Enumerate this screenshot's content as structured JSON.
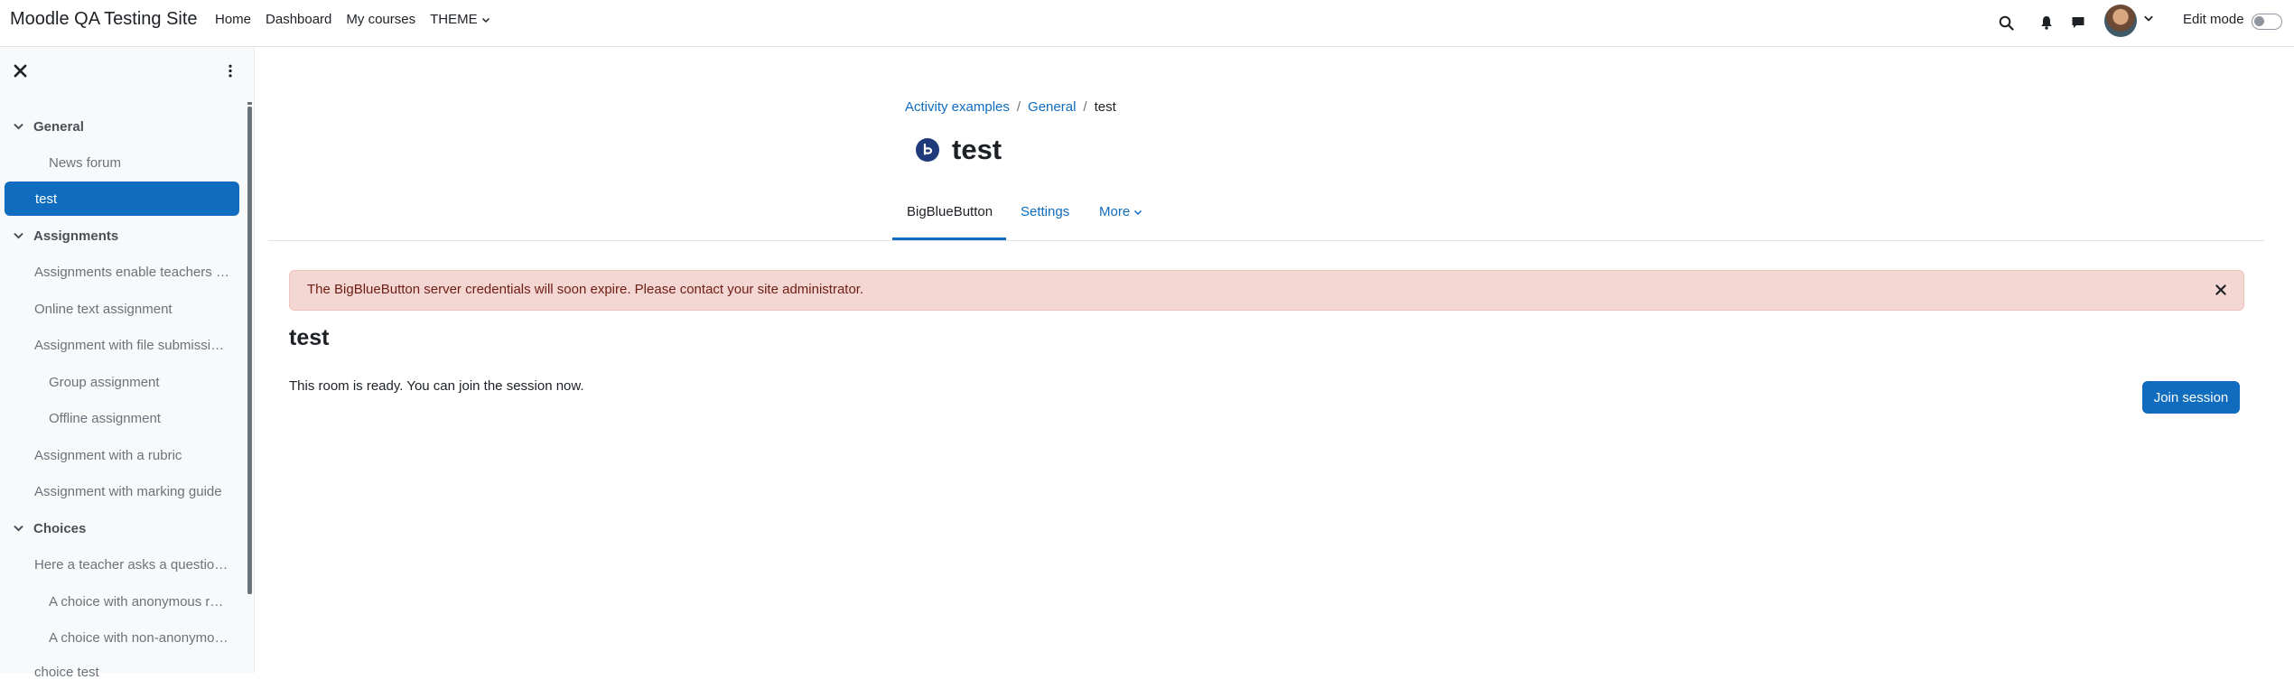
{
  "site": {
    "title": "Moodle QA Testing Site"
  },
  "primary_nav": [
    {
      "label": "Home"
    },
    {
      "label": "Dashboard"
    },
    {
      "label": "My courses"
    },
    {
      "label": "THEME"
    }
  ],
  "user_menu": {
    "edit_mode_label": "Edit mode",
    "edit_mode_on": false
  },
  "course_index": {
    "items": [
      {
        "type": "section",
        "label": "General"
      },
      {
        "type": "activity",
        "label": "News forum",
        "indent": 2
      },
      {
        "type": "activity",
        "label": "test",
        "indent": 1,
        "active": true
      },
      {
        "type": "section",
        "label": "Assignments"
      },
      {
        "type": "activity",
        "label": "Assignments enable teachers …",
        "indent": 1
      },
      {
        "type": "activity",
        "label": "Online text assignment",
        "indent": 1
      },
      {
        "type": "activity",
        "label": "Assignment with file submissi…",
        "indent": 1
      },
      {
        "type": "activity",
        "label": "Group assignment",
        "indent": 2
      },
      {
        "type": "activity",
        "label": "Offline assignment",
        "indent": 2
      },
      {
        "type": "activity",
        "label": "Assignment with a rubric",
        "indent": 1
      },
      {
        "type": "activity",
        "label": "Assignment with marking guide",
        "indent": 1
      },
      {
        "type": "section",
        "label": "Choices"
      },
      {
        "type": "activity",
        "label": "Here a teacher asks a questio…",
        "indent": 1
      },
      {
        "type": "activity",
        "label": "A choice with anonymous r…",
        "indent": 2
      },
      {
        "type": "activity",
        "label": "A choice with non-anonymo…",
        "indent": 2
      },
      {
        "type": "activity",
        "label": "choice test",
        "indent": 1
      }
    ]
  },
  "breadcrumb": [
    "Activity examples",
    "General",
    "test"
  ],
  "page": {
    "title": "test"
  },
  "secondary_nav": {
    "tabs": [
      {
        "label": "BigBlueButton",
        "active": true
      },
      {
        "label": "Settings"
      },
      {
        "label": "More"
      }
    ]
  },
  "alert": {
    "text": "The BigBlueButton server credentials will soon expire. Please contact your site administrator."
  },
  "content": {
    "heading": "test",
    "status": "This room is ready. You can join the session now.",
    "join_label": "Join session"
  },
  "colors": {
    "primary": "#0f6cbf",
    "alert_bg": "#f4d6d2",
    "alert_text": "#6e1d14"
  }
}
